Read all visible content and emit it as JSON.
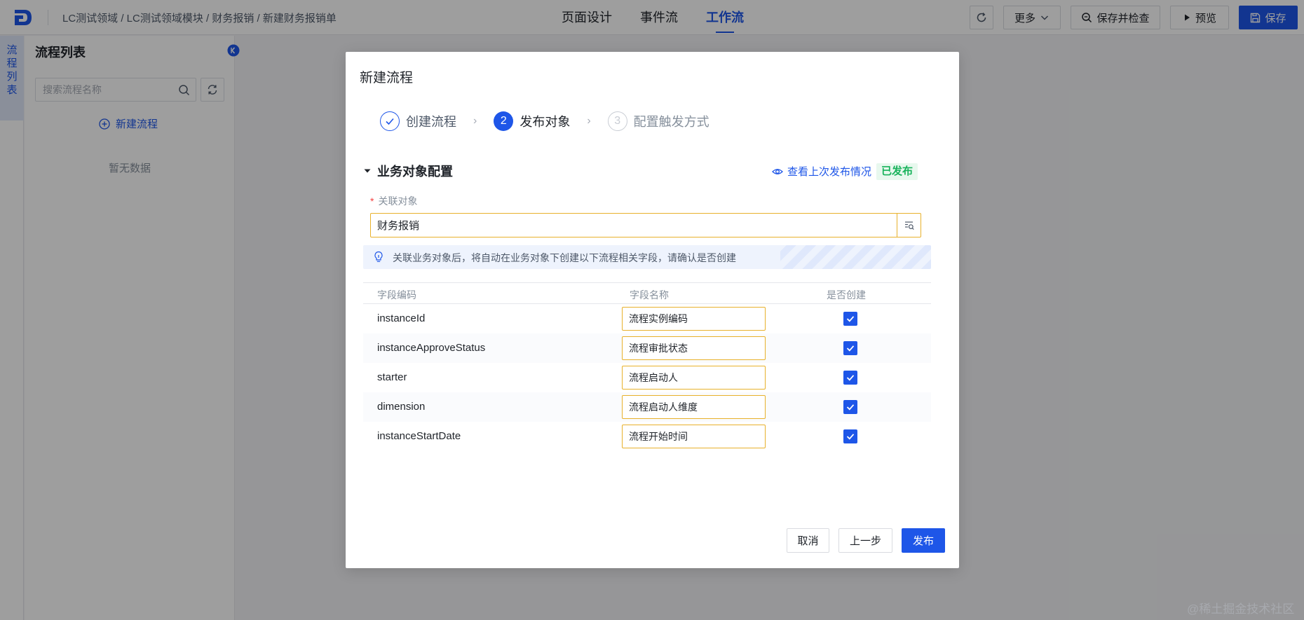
{
  "topbar": {
    "breadcrumb": "LC测试领域 / LC测试领域模块 / 财务报销 / 新建财务报销单",
    "tabs": [
      {
        "label": "页面设计",
        "active": false
      },
      {
        "label": "事件流",
        "active": false
      },
      {
        "label": "工作流",
        "active": true
      }
    ],
    "more_label": "更多",
    "save_check_label": "保存并检查",
    "preview_label": "预览",
    "save_label": "保存"
  },
  "strip": {
    "tab_chars": [
      "流",
      "程",
      "列",
      "表"
    ]
  },
  "panel": {
    "title": "流程列表",
    "search_placeholder": "搜索流程名称",
    "new_flow_label": "新建流程",
    "empty_text": "暂无数据"
  },
  "dialog": {
    "title": "新建流程",
    "steps": [
      {
        "number": "1",
        "label": "创建流程",
        "state": "done"
      },
      {
        "number": "2",
        "label": "发布对象",
        "state": "current"
      },
      {
        "number": "3",
        "label": "配置触发方式",
        "state": "todo"
      }
    ],
    "section_title": "业务对象配置",
    "view_last_label": "查看上次发布情况",
    "published_badge": "已发布",
    "field_label": "关联对象",
    "field_required_mark": "*",
    "field_value": "财务报销",
    "alert_text": "关联业务对象后，将自动在业务对象下创建以下流程相关字段，请确认是否创建",
    "table": {
      "headers": {
        "code": "字段编码",
        "name": "字段名称",
        "create": "是否创建"
      },
      "rows": [
        {
          "code": "instanceId",
          "name": "流程实例编码",
          "create": true
        },
        {
          "code": "instanceApproveStatus",
          "name": "流程审批状态",
          "create": true
        },
        {
          "code": "starter",
          "name": "流程启动人",
          "create": true
        },
        {
          "code": "dimension",
          "name": "流程启动人维度",
          "create": true
        },
        {
          "code": "instanceStartDate",
          "name": "流程开始时间",
          "create": true
        }
      ]
    },
    "cancel_label": "取消",
    "prev_label": "上一步",
    "publish_label": "发布"
  },
  "watermark": "@稀土掘金技术社区",
  "colors": {
    "accent": "#1e56e8",
    "success": "#19b35c",
    "warning_border": "#e8b12b",
    "required": "#f53f3f"
  }
}
